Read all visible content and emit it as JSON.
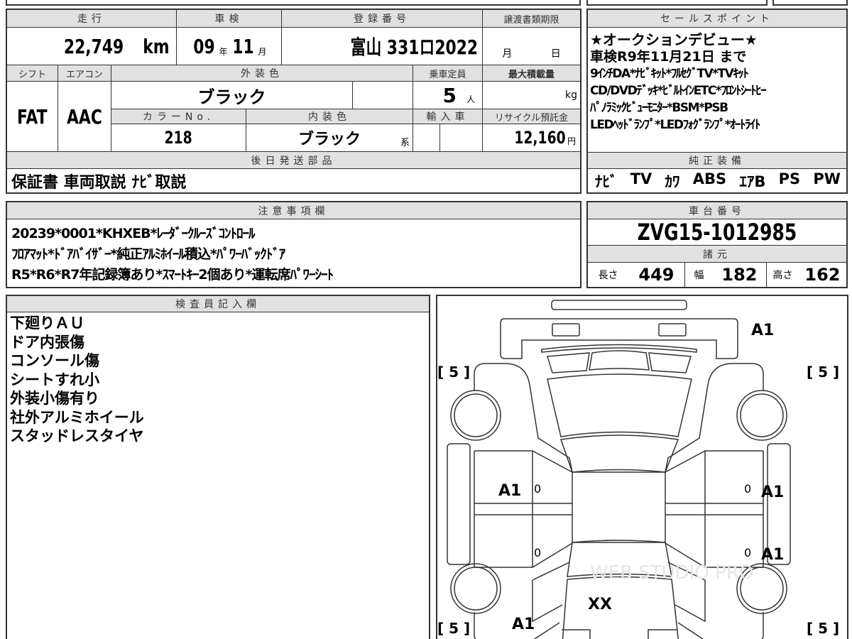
{
  "top_table": {
    "headers": {
      "mileage": "走行",
      "inspection": "車検",
      "registration": "登録番号",
      "transfer_deadline": "譲渡書類期限"
    },
    "mileage": "22,749",
    "mileage_unit": "km",
    "inspection_year": "09",
    "year_unit": "年",
    "inspection_month": "11",
    "month_unit": "月",
    "registration": "富山 331ロ2022",
    "deadline_month": "月",
    "deadline_day": "日",
    "headers2": {
      "shift": "シフト",
      "aircon": "エアコン",
      "exterior_color": "外装色",
      "capacity": "乗車定員",
      "max_load": "最大積載量"
    },
    "shift": "FAT",
    "aircon": "AAC",
    "exterior_color": "ブラック",
    "capacity": "5",
    "capacity_unit": "人",
    "max_load_unit": "kg",
    "headers3": {
      "color_no": "カラーNo.",
      "interior_color": "内装色",
      "import": "輸入車",
      "recycle_fee": "リサイクル預託金"
    },
    "color_no": "218",
    "interior_color": "ブラック",
    "interior_suffix": "系",
    "recycle_fee": "12,160",
    "recycle_unit": "円",
    "later_parts_header": "後日発送部品",
    "later_parts": "保証書 車両取説 ﾅﾋﾞ取説"
  },
  "sales_points": {
    "header": "セールスポイント",
    "lines": [
      "★オークションデビュー★",
      "車検R9年11月21日 まで",
      "9ｲﾝﾁDA*ﾅﾋﾞｷｯﾄ*ﾌﾙｾｸﾞTV*TVｷｯﾄ",
      "CD/DVDﾃﾞｯｷ*ﾋﾞﾙﾄｲﾝETC*ﾌﾛﾝﾄｼｰﾄﾋｰ",
      "ﾊﾟﾉﾗﾐｯｸﾋﾞｭｰﾓﾆﾀｰ*BSM*PSB",
      "LEDﾍｯﾄﾞﾗﾝﾌﾟ*LEDﾌｫｸﾞﾗﾝﾌﾟ*ｵｰﾄﾗｲﾄ"
    ]
  },
  "equipment": {
    "header": "純正装備",
    "items": [
      "ﾅﾋﾞ",
      "TV",
      "ｶﾜ",
      "ABS",
      "ｴｱB",
      "PS",
      "PW"
    ]
  },
  "notes": {
    "header": "注意事項欄",
    "lines": [
      "20239*0001*KHXEB*ﾚｰﾀﾞｰｸﾙｰｽﾞｺﾝﾄﾛｰﾙ",
      "ﾌﾛｱﾏｯﾄ*ﾄﾞｱﾊﾞｲｻﾞｰ*純正ｱﾙﾐﾎｲｰﾙ積込*ﾊﾟﾜｰﾊﾞｯｸﾄﾞｱ",
      "R5*R6*R7年記録簿あり*ｽﾏｰﾄｷｰ2個あり*運転席ﾊﾟﾜｰｼｰﾄ"
    ]
  },
  "chassis": {
    "header": "車台番号",
    "number": "ZVG15-1012985",
    "spec_header": "諸元",
    "length_label": "長さ",
    "length": "449",
    "width_label": "幅",
    "width": "182",
    "height_label": "高さ",
    "height": "162"
  },
  "inspector": {
    "header": "検査員記入欄",
    "lines": [
      "下廻りＡＵ",
      "ドア内張傷",
      "コンソール傷",
      "シートすれ小",
      "外装小傷有り",
      "社外アルミホイール",
      "スタッドレスタイヤ"
    ]
  },
  "diagram": {
    "tread_fl": "[ 5 ]",
    "tread_fr": "[ 5 ]",
    "tread_rl": "[ 5 ]",
    "tread_rr": "[ 5 ]",
    "front": "A1",
    "left_front_door": "A1",
    "right_front_door": "A1",
    "right_rear_door": "A1",
    "left_rear": "A1",
    "rear": "XX",
    "zero": "0",
    "watermark": "WEB STUDIO PRO"
  }
}
